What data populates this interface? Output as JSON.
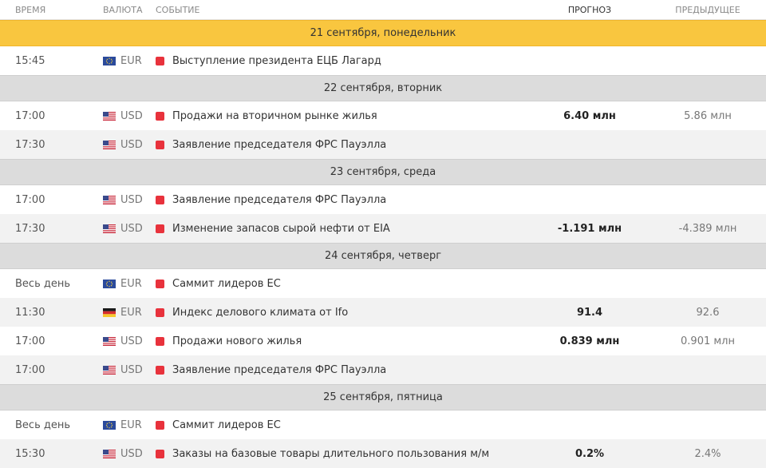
{
  "headers": {
    "time": "Время",
    "currency": "Валюта",
    "event": "Событие",
    "forecast": "Прогноз",
    "previous": "Предыдущее"
  },
  "days": [
    {
      "label": "21 сентября, понедельник",
      "highlight": true,
      "events": [
        {
          "time": "15:45",
          "flag": "eu-flag-icon",
          "currency": "EUR",
          "event": "Выступление президента ЕЦБ Лагард",
          "forecast": "",
          "previous": ""
        }
      ]
    },
    {
      "label": "22 сентября, вторник",
      "highlight": false,
      "events": [
        {
          "time": "17:00",
          "flag": "us-flag-icon",
          "currency": "USD",
          "event": "Продажи на вторичном рынке жилья",
          "forecast": "6.40 млн",
          "previous": "5.86 млн"
        },
        {
          "time": "17:30",
          "flag": "us-flag-icon",
          "currency": "USD",
          "event": "Заявление председателя ФРС Пауэлла",
          "forecast": "",
          "previous": ""
        }
      ]
    },
    {
      "label": "23 сентября, среда",
      "highlight": false,
      "events": [
        {
          "time": "17:00",
          "flag": "us-flag-icon",
          "currency": "USD",
          "event": "Заявление председателя ФРС Пауэлла",
          "forecast": "",
          "previous": ""
        },
        {
          "time": "17:30",
          "flag": "us-flag-icon",
          "currency": "USD",
          "event": "Изменение запасов сырой нефти от EIA",
          "forecast": "-1.191 млн",
          "previous": "-4.389 млн"
        }
      ]
    },
    {
      "label": "24 сентября, четверг",
      "highlight": false,
      "events": [
        {
          "time": "Весь день",
          "flag": "eu-flag-icon",
          "currency": "EUR",
          "event": "Саммит лидеров ЕС",
          "forecast": "",
          "previous": ""
        },
        {
          "time": "11:30",
          "flag": "de-flag-icon",
          "currency": "EUR",
          "event": "Индекс делового климата от Ifo",
          "forecast": "91.4",
          "previous": "92.6"
        },
        {
          "time": "17:00",
          "flag": "us-flag-icon",
          "currency": "USD",
          "event": "Продажи нового жилья",
          "forecast": "0.839 млн",
          "previous": "0.901 млн"
        },
        {
          "time": "17:00",
          "flag": "us-flag-icon",
          "currency": "USD",
          "event": "Заявление председателя ФРС Пауэлла",
          "forecast": "",
          "previous": ""
        }
      ]
    },
    {
      "label": "25 сентября, пятница",
      "highlight": false,
      "events": [
        {
          "time": "Весь день",
          "flag": "eu-flag-icon",
          "currency": "EUR",
          "event": "Саммит лидеров ЕС",
          "forecast": "",
          "previous": ""
        },
        {
          "time": "15:30",
          "flag": "us-flag-icon",
          "currency": "USD",
          "event": "Заказы на базовые товары длительного пользования м/м",
          "forecast": "0.2%",
          "previous": "2.4%"
        }
      ]
    }
  ],
  "colors": {
    "highlight_bar": "#f9c63f",
    "day_bar": "#dcdcdc",
    "importance_high": "#e8323c",
    "row_alt": "#f2f2f2"
  },
  "importance_icon": "high-importance-icon"
}
